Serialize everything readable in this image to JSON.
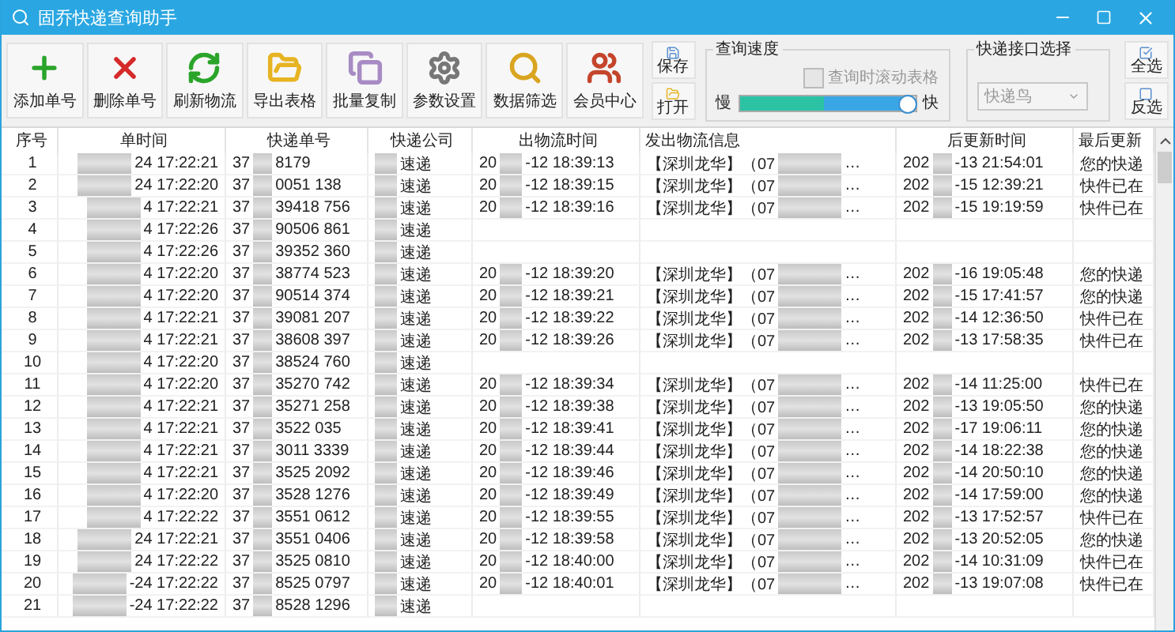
{
  "window": {
    "title": "固乔快递查询助手"
  },
  "toolbar": [
    {
      "label": "添加单号",
      "kind": "add"
    },
    {
      "label": "删除单号",
      "kind": "delete"
    },
    {
      "label": "刷新物流",
      "kind": "refresh"
    },
    {
      "label": "导出表格",
      "kind": "export"
    },
    {
      "label": "批量复制",
      "kind": "copy"
    },
    {
      "label": "参数设置",
      "kind": "settings"
    },
    {
      "label": "数据筛选",
      "kind": "filter"
    },
    {
      "label": "会员中心",
      "kind": "members"
    }
  ],
  "file_buttons": [
    {
      "label": "保存",
      "kind": "save"
    },
    {
      "label": "打开",
      "kind": "open"
    }
  ],
  "speed": {
    "title": "查询速度",
    "scroll_checkbox": {
      "label": "查询时滚动表格",
      "checked": false,
      "disabled": true
    },
    "slow": "慢",
    "fast": "快",
    "level": 0.96
  },
  "api": {
    "title": "快递接口选择",
    "value": "快递鸟",
    "disabled": true
  },
  "select_buttons": [
    {
      "label": "全选",
      "kind": "all"
    },
    {
      "label": "反选",
      "kind": "invert"
    }
  ],
  "table": {
    "columns": [
      "序号",
      "单时间",
      "快递单号",
      "快递公司",
      "出物流时间",
      "发出物流信息",
      "后更新时间",
      "最后更新"
    ],
    "rows": [
      {
        "no": "1",
        "time": "24 17:22:21",
        "number_head": "37",
        "number": "8179",
        "company": "速递",
        "sent_head": "20",
        "sent": "-12 18:39:13",
        "info_head": "【深圳龙华】（07",
        "info": "…",
        "updated_head": "202",
        "updated": "-13 21:54:01",
        "last": "您的快递"
      },
      {
        "no": "2",
        "time": "24 17:22:20",
        "number_head": "37",
        "number": "0051 138",
        "company": "速递",
        "sent_head": "20",
        "sent": "-12 18:39:15",
        "info_head": "【深圳龙华】（07",
        "info": "…",
        "updated_head": "202",
        "updated": "-15 12:39:21",
        "last": "快件已在"
      },
      {
        "no": "3",
        "time": "4 17:22:21",
        "number_head": "37",
        "number": "39418 756",
        "company": "速递",
        "sent_head": "20",
        "sent": "-12 18:39:16",
        "info_head": "【深圳龙华】（07",
        "info": "…",
        "updated_head": "202",
        "updated": "-15 19:19:59",
        "last": "快件已在"
      },
      {
        "no": "4",
        "time": "4 17:22:26",
        "number_head": "37",
        "number": "90506 861",
        "company": "速递"
      },
      {
        "no": "5",
        "time": "4 17:22:26",
        "number_head": "37",
        "number": "39352 360",
        "company": "速递"
      },
      {
        "no": "6",
        "time": "4 17:22:20",
        "number_head": "37",
        "number": "38774 523",
        "company": "速递",
        "sent_head": "20",
        "sent": "-12 18:39:20",
        "info_head": "【深圳龙华】（07",
        "info": "…",
        "updated_head": "202",
        "updated": "-16 19:05:48",
        "last": "您的快递"
      },
      {
        "no": "7",
        "time": "4 17:22:20",
        "number_head": "37",
        "number": "90514 374",
        "company": "速递",
        "sent_head": "20",
        "sent": "-12 18:39:21",
        "info_head": "【深圳龙华】（07",
        "info": "…",
        "updated_head": "202",
        "updated": "-15 17:41:57",
        "last": "您的快递"
      },
      {
        "no": "8",
        "time": "4 17:22:21",
        "number_head": "37",
        "number": "39081 207",
        "company": "速递",
        "sent_head": "20",
        "sent": "-12 18:39:22",
        "info_head": "【深圳龙华】（07",
        "info": "…",
        "updated_head": "202",
        "updated": "-14 12:36:50",
        "last": "快件已在"
      },
      {
        "no": "9",
        "time": "4 17:22:21",
        "number_head": "37",
        "number": "38608 397",
        "company": "速递",
        "sent_head": "20",
        "sent": "-12 18:39:26",
        "info_head": "【深圳龙华】（07",
        "info": "…",
        "updated_head": "202",
        "updated": "-13 17:58:35",
        "last": "快件已在"
      },
      {
        "no": "10",
        "time": "4 17:22:20",
        "number_head": "37",
        "number": "38524 760",
        "company": "速递"
      },
      {
        "no": "11",
        "time": "4 17:22:20",
        "number_head": "37",
        "number": "35270 742",
        "company": "速递",
        "sent_head": "20",
        "sent": "-12 18:39:34",
        "info_head": "【深圳龙华】（07",
        "info": "…",
        "updated_head": "202",
        "updated": "-14 11:25:00",
        "last": "快件已在"
      },
      {
        "no": "12",
        "time": "4 17:22:21",
        "number_head": "37",
        "number": "35271 258",
        "company": "速递",
        "sent_head": "20",
        "sent": "-12 18:39:38",
        "info_head": "【深圳龙华】（07",
        "info": "…",
        "updated_head": "202",
        "updated": "-13 19:05:50",
        "last": "您的快递"
      },
      {
        "no": "13",
        "time": "4 17:22:21",
        "number_head": "37",
        "number": "3522 035",
        "company": "速递",
        "sent_head": "20",
        "sent": "-12 18:39:41",
        "info_head": "【深圳龙华】（07",
        "info": "…",
        "updated_head": "202",
        "updated": "-17 19:06:11",
        "last": "您的快递"
      },
      {
        "no": "14",
        "time": "4 17:22:21",
        "number_head": "37",
        "number": "3011 3339",
        "company": "速递",
        "sent_head": "20",
        "sent": "-12 18:39:44",
        "info_head": "【深圳龙华】（07",
        "info": "…",
        "updated_head": "202",
        "updated": "-14 18:22:38",
        "last": "您的快递"
      },
      {
        "no": "15",
        "time": "4 17:22:21",
        "number_head": "37",
        "number": "3525 2092",
        "company": "速递",
        "sent_head": "20",
        "sent": "-12 18:39:46",
        "info_head": "【深圳龙华】（07",
        "info": "…",
        "updated_head": "202",
        "updated": "-14 20:50:10",
        "last": "您的快递"
      },
      {
        "no": "16",
        "time": "4 17:22:20",
        "number_head": "37",
        "number": "3528 1276",
        "company": "速递",
        "sent_head": "20",
        "sent": "-12 18:39:49",
        "info_head": "【深圳龙华】（07",
        "info": "…",
        "updated_head": "202",
        "updated": "-14 17:59:00",
        "last": "您的快递"
      },
      {
        "no": "17",
        "time": "4 17:22:22",
        "number_head": "37",
        "number": "3551 0612",
        "company": "速递",
        "sent_head": "20",
        "sent": "-12 18:39:55",
        "info_head": "【深圳龙华】（07",
        "info": "…",
        "updated_head": "202",
        "updated": "-13 17:52:57",
        "last": "快件已在"
      },
      {
        "no": "18",
        "time": "24 17:22:21",
        "number_head": "37",
        "number": "3551 0406",
        "company": "速递",
        "sent_head": "20",
        "sent": "-12 18:39:58",
        "info_head": "【深圳龙华】（07",
        "info": "…",
        "updated_head": "202",
        "updated": "-13 20:52:05",
        "last": "您的快递"
      },
      {
        "no": "19",
        "time": "24 17:22:22",
        "number_head": "37",
        "number": "3525 0810",
        "company": "速递",
        "sent_head": "20",
        "sent": "-12 18:40:00",
        "info_head": "【深圳龙华】（07",
        "info": "…",
        "updated_head": "202",
        "updated": "-14 10:31:09",
        "last": "快件已在"
      },
      {
        "no": "20",
        "time": "-24 17:22:22",
        "number_head": "37",
        "number": "8525 0797",
        "company": "速递",
        "sent_head": "20",
        "sent": "-12 18:40:01",
        "info_head": "【深圳龙华】（07",
        "info": "…",
        "updated_head": "202",
        "updated": "-13 19:07:08",
        "last": "快件已在"
      },
      {
        "no": "21",
        "time": "-24 17:22:22",
        "number_head": "37",
        "number": "8528 1296",
        "company": "速递"
      }
    ]
  }
}
